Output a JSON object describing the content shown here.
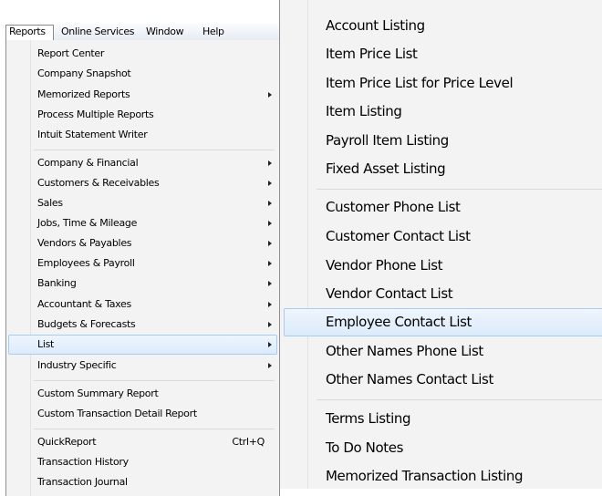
{
  "menubar": {
    "items": [
      {
        "label": "Reports",
        "active": true
      },
      {
        "label": "Online Services",
        "active": false
      },
      {
        "label": "Window",
        "active": false
      },
      {
        "label": "Help",
        "active": false
      }
    ]
  },
  "reports_menu": {
    "items": [
      {
        "label": "Report Center"
      },
      {
        "label": "Company Snapshot"
      },
      {
        "label": "Memorized Reports",
        "submenu": true
      },
      {
        "label": "Process Multiple Reports"
      },
      {
        "label": "Intuit Statement Writer"
      },
      {
        "label": "Company & Financial",
        "submenu": true
      },
      {
        "label": "Customers & Receivables",
        "submenu": true
      },
      {
        "label": "Sales",
        "submenu": true
      },
      {
        "label": "Jobs, Time & Mileage",
        "submenu": true
      },
      {
        "label": "Vendors & Payables",
        "submenu": true
      },
      {
        "label": "Employees & Payroll",
        "submenu": true
      },
      {
        "label": "Banking",
        "submenu": true
      },
      {
        "label": "Accountant & Taxes",
        "submenu": true
      },
      {
        "label": "Budgets & Forecasts",
        "submenu": true
      },
      {
        "label": "List",
        "submenu": true,
        "highlighted": true
      },
      {
        "label": "Industry Specific",
        "submenu": true
      },
      {
        "label": "Custom Summary Report"
      },
      {
        "label": "Custom Transaction Detail Report"
      },
      {
        "label": "QuickReport",
        "shortcut": "Ctrl+Q"
      },
      {
        "label": "Transaction History"
      },
      {
        "label": "Transaction Journal"
      }
    ]
  },
  "list_submenu": {
    "items": [
      {
        "label": "Account Listing"
      },
      {
        "label": "Item Price List"
      },
      {
        "label": "Item Price List for Price Level"
      },
      {
        "label": "Item Listing"
      },
      {
        "label": "Payroll Item Listing"
      },
      {
        "label": "Fixed Asset Listing"
      },
      {
        "label": "Customer Phone List"
      },
      {
        "label": "Customer Contact List"
      },
      {
        "label": "Vendor Phone List"
      },
      {
        "label": "Vendor Contact List"
      },
      {
        "label": "Employee Contact List",
        "highlighted": true
      },
      {
        "label": "Other Names Phone List"
      },
      {
        "label": "Other Names Contact List"
      },
      {
        "label": "Terms Listing"
      },
      {
        "label": "To Do Notes"
      },
      {
        "label": "Memorized Transaction Listing"
      }
    ]
  },
  "colors": {
    "highlight_fill": "#dcebfc",
    "highlight_border": "#a8cbf2",
    "menu_background": "#f3f3f3"
  }
}
